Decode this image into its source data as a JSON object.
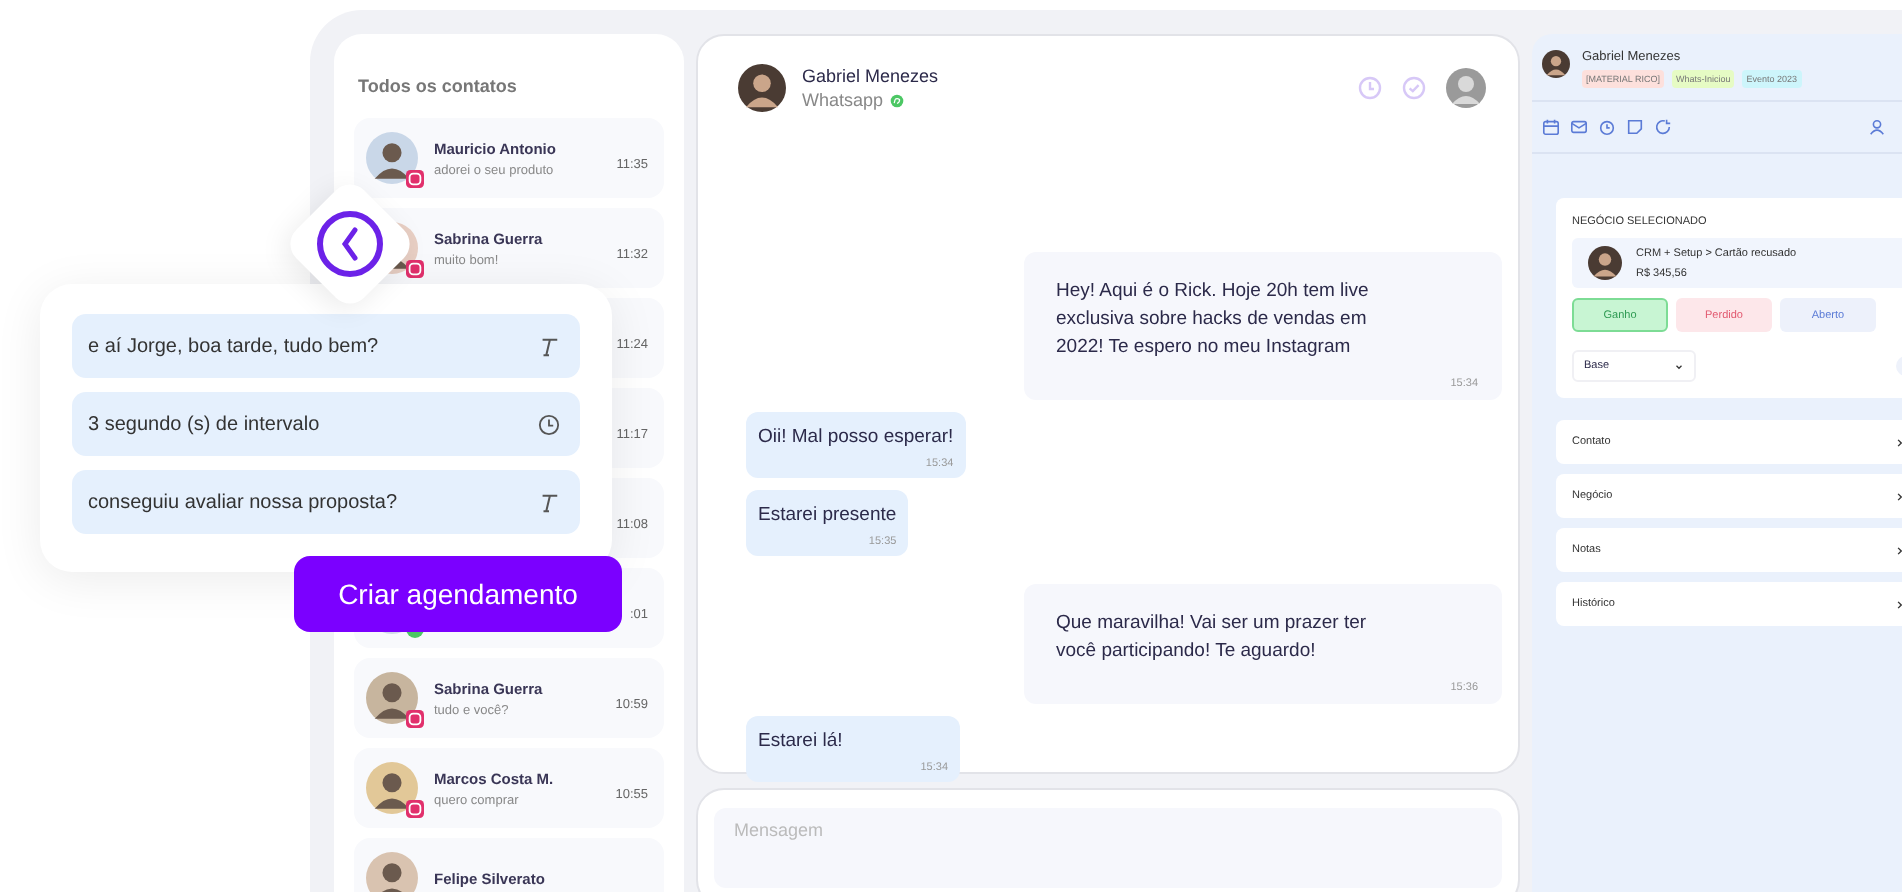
{
  "contacts": {
    "title": "Todos os contatos",
    "items": [
      {
        "name": "Mauricio Antonio",
        "preview": "adorei o seu produto",
        "time": "11:35",
        "kind": "instagram"
      },
      {
        "name": "Sabrina Guerra",
        "preview": "muito bom!",
        "time": "11:32",
        "kind": "instagram"
      },
      {
        "time": "11:24"
      },
      {
        "time": "11:17"
      },
      {
        "time": "11:08"
      },
      {
        "time": ":01",
        "kind": "whatsapp"
      },
      {
        "name": "Sabrina Guerra",
        "preview": "tudo e você?",
        "time": "10:59",
        "kind": "instagram"
      },
      {
        "name": "Marcos Costa M.",
        "preview": "quero comprar",
        "time": "10:55",
        "kind": "instagram"
      },
      {
        "name": "Felipe Silverato"
      }
    ]
  },
  "chat": {
    "contact": "Gabriel Menezes",
    "channel": "Whatsapp",
    "messages": [
      {
        "kind": "out",
        "text": "Hey! Aqui é o Rick. Hoje 20h tem live exclusiva sobre hacks de vendas em 2022! Te espero no meu Instagram",
        "time": "15:34"
      },
      {
        "kind": "in",
        "text": "Oii! Mal posso esperar!",
        "time": "15:34"
      },
      {
        "kind": "in",
        "text": "Estarei presente",
        "time": "15:35"
      },
      {
        "kind": "out",
        "text": "Que maravilha! Vai ser um prazer ter você participando! Te aguardo!",
        "time": "15:36"
      },
      {
        "kind": "in",
        "text": "Estarei lá!",
        "time": "15:34"
      }
    ],
    "input": {
      "placeholder": "Mensagem"
    }
  },
  "details": {
    "contact": "Gabriel Menezes",
    "tags": [
      {
        "label": "[MATERIAL RICO]",
        "color": "#fde0dc"
      },
      {
        "label": "Whats-Iniciou",
        "color": "#e6fbc4"
      },
      {
        "label": "Evento 2023",
        "color": "#cdf5fb"
      }
    ],
    "deal": {
      "title": "NEGÓCIO SELECIONADO",
      "name": "CRM + Setup > Cartão recusado",
      "value": "R$ 345,56",
      "statuses": [
        {
          "label": "Ganho",
          "kind": "won",
          "selected": true
        },
        {
          "label": "Perdido",
          "kind": "lost",
          "selected": false
        },
        {
          "label": "Aberto",
          "kind": "open",
          "selected": false
        }
      ],
      "pipeline": "Base"
    },
    "sections": [
      {
        "label": "Contato"
      },
      {
        "label": "Negócio"
      },
      {
        "label": "Notas"
      },
      {
        "label": "Histórico"
      }
    ]
  },
  "schedule": {
    "steps": [
      {
        "kind": "text",
        "text": "e aí Jorge, boa tarde, tudo bem?"
      },
      {
        "kind": "delay",
        "text": "3 segundo (s) de intervalo"
      },
      {
        "kind": "text",
        "text": "conseguiu avaliar nossa proposta?"
      }
    ],
    "button": "Criar agendamento"
  }
}
